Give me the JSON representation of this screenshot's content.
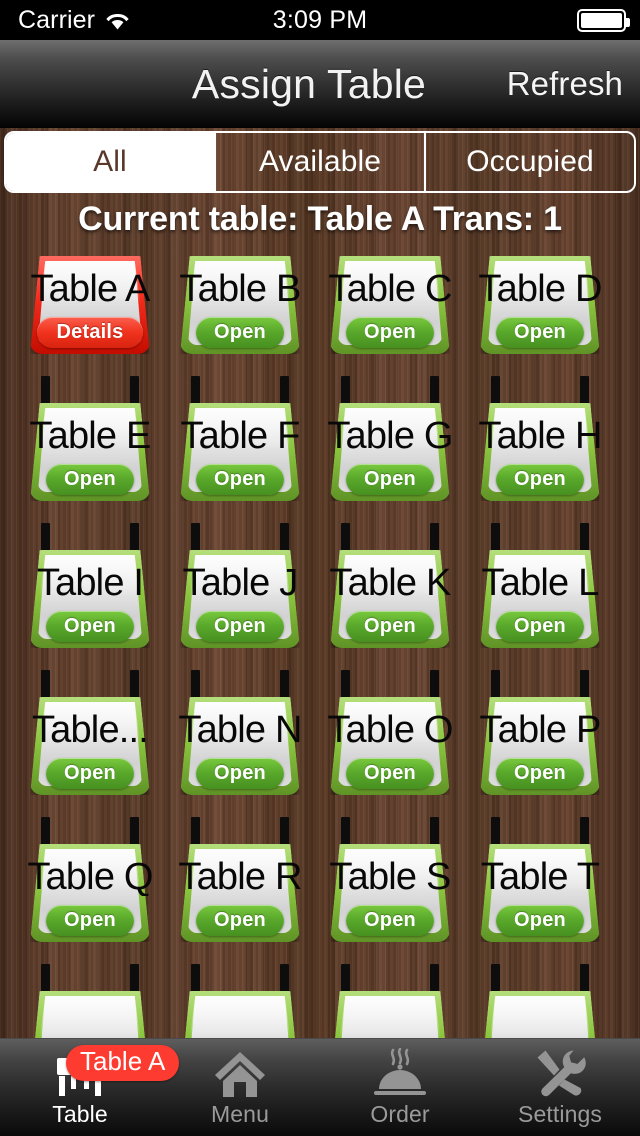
{
  "status_bar": {
    "carrier": "Carrier",
    "wifi_icon": "wifi-icon",
    "time": "3:09 PM",
    "battery_icon": "battery-full-icon"
  },
  "nav_bar": {
    "title": "Assign Table",
    "refresh_label": "Refresh"
  },
  "segmented_control": {
    "selected_index": 0,
    "segments": [
      {
        "label": "All",
        "selected": true
      },
      {
        "label": "Available",
        "selected": false
      },
      {
        "label": "Occupied",
        "selected": false
      }
    ]
  },
  "header": {
    "current_table_text": "Current table: Table A Trans: 1",
    "current_table_name": "Table A",
    "transaction_count": "1"
  },
  "colors": {
    "open_green": "#59a82b",
    "open_border_green": "#8cc63f",
    "occupied_red": "#f0341f",
    "occupied_border_red": "#f22b1c",
    "badge_red": "#fe3b30",
    "wood_brown": "#5b3a27",
    "segment_text_brown": "#59392a"
  },
  "tables": [
    {
      "label": "Table A",
      "status_label": "Details",
      "status": "occupied"
    },
    {
      "label": "Table B",
      "status_label": "Open",
      "status": "open"
    },
    {
      "label": "Table C",
      "status_label": "Open",
      "status": "open"
    },
    {
      "label": "Table D",
      "status_label": "Open",
      "status": "open"
    },
    {
      "label": "Table E",
      "status_label": "Open",
      "status": "open"
    },
    {
      "label": "Table F",
      "status_label": "Open",
      "status": "open"
    },
    {
      "label": "Table G",
      "status_label": "Open",
      "status": "open"
    },
    {
      "label": "Table H",
      "status_label": "Open",
      "status": "open"
    },
    {
      "label": "Table I",
      "status_label": "Open",
      "status": "open"
    },
    {
      "label": "Table J",
      "status_label": "Open",
      "status": "open"
    },
    {
      "label": "Table K",
      "status_label": "Open",
      "status": "open"
    },
    {
      "label": "Table L",
      "status_label": "Open",
      "status": "open"
    },
    {
      "label": "Table...",
      "status_label": "Open",
      "status": "open"
    },
    {
      "label": "Table N",
      "status_label": "Open",
      "status": "open"
    },
    {
      "label": "Table O",
      "status_label": "Open",
      "status": "open"
    },
    {
      "label": "Table P",
      "status_label": "Open",
      "status": "open"
    },
    {
      "label": "Table Q",
      "status_label": "Open",
      "status": "open"
    },
    {
      "label": "Table R",
      "status_label": "Open",
      "status": "open"
    },
    {
      "label": "Table S",
      "status_label": "Open",
      "status": "open"
    },
    {
      "label": "Table T",
      "status_label": "Open",
      "status": "open"
    },
    {
      "label": "",
      "status_label": "",
      "status": "open"
    },
    {
      "label": "",
      "status_label": "",
      "status": "open"
    },
    {
      "label": "",
      "status_label": "",
      "status": "open"
    },
    {
      "label": "",
      "status_label": "",
      "status": "open"
    }
  ],
  "tab_bar": {
    "items": [
      {
        "label": "Table",
        "icon": "table-icon",
        "active": true,
        "badge": "Table A"
      },
      {
        "label": "Menu",
        "icon": "house-icon",
        "active": false,
        "badge": null
      },
      {
        "label": "Order",
        "icon": "cloche-icon",
        "active": false,
        "badge": null
      },
      {
        "label": "Settings",
        "icon": "tools-icon",
        "active": false,
        "badge": null
      }
    ]
  }
}
